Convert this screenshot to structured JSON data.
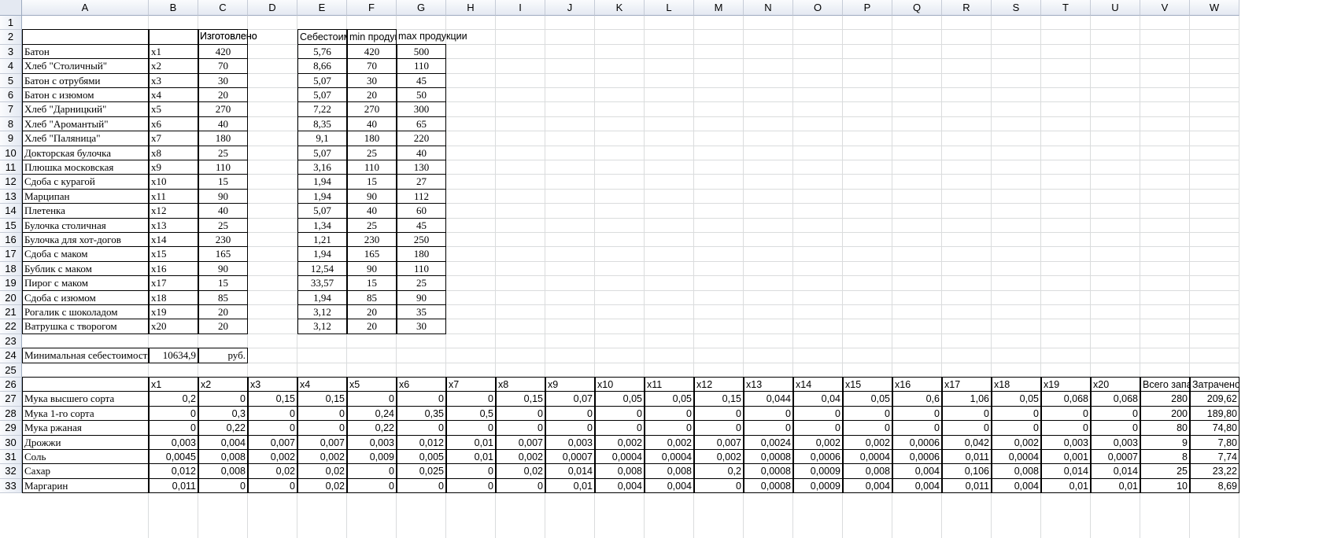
{
  "columns": [
    "A",
    "B",
    "C",
    "D",
    "E",
    "F",
    "G",
    "H",
    "I",
    "J",
    "K",
    "L",
    "M",
    "N",
    "O",
    "P",
    "Q",
    "R",
    "S",
    "T",
    "U",
    "V",
    "W"
  ],
  "row_numbers": [
    1,
    2,
    3,
    4,
    5,
    6,
    7,
    8,
    9,
    10,
    11,
    12,
    13,
    14,
    15,
    16,
    17,
    18,
    19,
    20,
    21,
    22,
    23,
    24,
    25,
    26,
    27,
    28,
    29,
    30,
    31,
    32,
    33
  ],
  "headers": {
    "made": "Изготовлено",
    "cost": "Себестоимость",
    "min": "min продукции",
    "max": "max продукции"
  },
  "products": [
    {
      "name": "Батон",
      "var": "x1",
      "made": "420",
      "cost": "5,76",
      "min": "420",
      "max": "500"
    },
    {
      "name": "Хлеб \"Столичный\"",
      "var": "x2",
      "made": "70",
      "cost": "8,66",
      "min": "70",
      "max": "110"
    },
    {
      "name": "Батон с отрубями",
      "var": "x3",
      "made": "30",
      "cost": "5,07",
      "min": "30",
      "max": "45"
    },
    {
      "name": "Батон с изюмом",
      "var": "x4",
      "made": "20",
      "cost": "5,07",
      "min": "20",
      "max": "50"
    },
    {
      "name": "Хлеб \"Дарницкий\"",
      "var": "x5",
      "made": "270",
      "cost": "7,22",
      "min": "270",
      "max": "300"
    },
    {
      "name": "Хлеб \"Аромантый\"",
      "var": "x6",
      "made": "40",
      "cost": "8,35",
      "min": "40",
      "max": "65"
    },
    {
      "name": "Хлеб \"Паляница\"",
      "var": "x7",
      "made": "180",
      "cost": "9,1",
      "min": "180",
      "max": "220"
    },
    {
      "name": "Докторская булочка",
      "var": "x8",
      "made": "25",
      "cost": "5,07",
      "min": "25",
      "max": "40"
    },
    {
      "name": "Плюшка московская",
      "var": "x9",
      "made": "110",
      "cost": "3,16",
      "min": "110",
      "max": "130"
    },
    {
      "name": "Сдоба с курагой",
      "var": "x10",
      "made": "15",
      "cost": "1,94",
      "min": "15",
      "max": "27"
    },
    {
      "name": "Марципан",
      "var": "x11",
      "made": "90",
      "cost": "1,94",
      "min": "90",
      "max": "112"
    },
    {
      "name": "Плетенка",
      "var": "x12",
      "made": "40",
      "cost": "5,07",
      "min": "40",
      "max": "60"
    },
    {
      "name": "Булочка столичная",
      "var": "x13",
      "made": "25",
      "cost": "1,34",
      "min": "25",
      "max": "45"
    },
    {
      "name": "Булочка для хот-догов",
      "var": "x14",
      "made": "230",
      "cost": "1,21",
      "min": "230",
      "max": "250"
    },
    {
      "name": "Сдоба с маком",
      "var": "x15",
      "made": "165",
      "cost": "1,94",
      "min": "165",
      "max": "180"
    },
    {
      "name": "Бублик с маком",
      "var": "x16",
      "made": "90",
      "cost": "12,54",
      "min": "90",
      "max": "110"
    },
    {
      "name": "Пирог с маком",
      "var": "x17",
      "made": "15",
      "cost": "33,57",
      "min": "15",
      "max": "25"
    },
    {
      "name": "Сдоба с изюмом",
      "var": "x18",
      "made": "85",
      "cost": "1,94",
      "min": "85",
      "max": "90"
    },
    {
      "name": "Рогалик с шоколадом",
      "var": "x19",
      "made": "20",
      "cost": "3,12",
      "min": "20",
      "max": "35"
    },
    {
      "name": "Ватрушка с творогом",
      "var": "x20",
      "made": "20",
      "cost": "3,12",
      "min": "20",
      "max": "30"
    }
  ],
  "min_cost": {
    "label": "Минимальная себестоимость",
    "value": "10634,9",
    "unit": "руб."
  },
  "resources": {
    "headers": [
      "x1",
      "x2",
      "x3",
      "x4",
      "x5",
      "x6",
      "x7",
      "x8",
      "x9",
      "x10",
      "x11",
      "x12",
      "x13",
      "x14",
      "x15",
      "x16",
      "x17",
      "x18",
      "x19",
      "x20",
      "Всего запасов",
      "Затрачено"
    ],
    "rows": [
      {
        "name": "Мука высшего сорта",
        "values": [
          "0,2",
          "0",
          "0,15",
          "0,15",
          "0",
          "0",
          "0",
          "0,15",
          "0,07",
          "0,05",
          "0,05",
          "0,15",
          "0,044",
          "0,04",
          "0,05",
          "0,6",
          "1,06",
          "0,05",
          "0,068",
          "0,068",
          "280",
          "209,62"
        ]
      },
      {
        "name": "Мука 1-го сорта",
        "values": [
          "0",
          "0,3",
          "0",
          "0",
          "0,24",
          "0,35",
          "0,5",
          "0",
          "0",
          "0",
          "0",
          "0",
          "0",
          "0",
          "0",
          "0",
          "0",
          "0",
          "0",
          "0",
          "200",
          "189,80"
        ]
      },
      {
        "name": "Мука ржаная",
        "values": [
          "0",
          "0,22",
          "0",
          "0",
          "0,22",
          "0",
          "0",
          "0",
          "0",
          "0",
          "0",
          "0",
          "0",
          "0",
          "0",
          "0",
          "0",
          "0",
          "0",
          "0",
          "80",
          "74,80"
        ]
      },
      {
        "name": "Дрожжи",
        "values": [
          "0,003",
          "0,004",
          "0,007",
          "0,007",
          "0,003",
          "0,012",
          "0,01",
          "0,007",
          "0,003",
          "0,002",
          "0,002",
          "0,007",
          "0,0024",
          "0,002",
          "0,002",
          "0,0006",
          "0,042",
          "0,002",
          "0,003",
          "0,003",
          "9",
          "7,80"
        ]
      },
      {
        "name": "Соль",
        "values": [
          "0,0045",
          "0,008",
          "0,002",
          "0,002",
          "0,009",
          "0,005",
          "0,01",
          "0,002",
          "0,0007",
          "0,0004",
          "0,0004",
          "0,002",
          "0,0008",
          "0,0006",
          "0,0004",
          "0,0006",
          "0,011",
          "0,0004",
          "0,001",
          "0,0007",
          "8",
          "7,74"
        ]
      },
      {
        "name": "Сахар",
        "values": [
          "0,012",
          "0,008",
          "0,02",
          "0,02",
          "0",
          "0,025",
          "0",
          "0,02",
          "0,014",
          "0,008",
          "0,008",
          "0,2",
          "0,0008",
          "0,0009",
          "0,008",
          "0,004",
          "0,106",
          "0,008",
          "0,014",
          "0,014",
          "25",
          "23,22"
        ]
      },
      {
        "name": "Маргарин",
        "values": [
          "0,011",
          "0",
          "0",
          "0,02",
          "0",
          "0",
          "0",
          "0",
          "0,01",
          "0,004",
          "0,004",
          "0",
          "0,0008",
          "0,0009",
          "0,004",
          "0,004",
          "0,011",
          "0,004",
          "0,01",
          "0,01",
          "10",
          "8,69"
        ]
      }
    ]
  }
}
